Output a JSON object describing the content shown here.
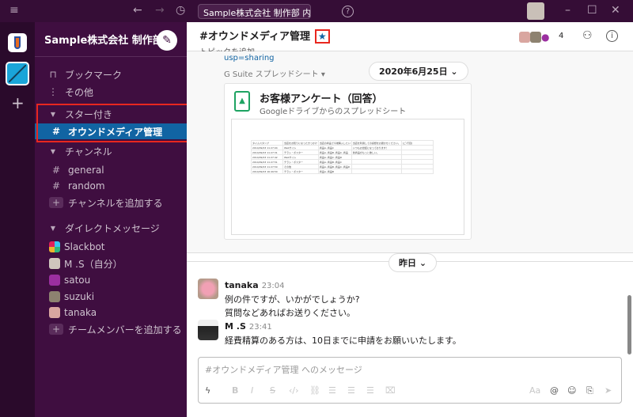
{
  "topbar": {
    "search_placeholder": "Sample株式会社 制作部 内を検...",
    "menu_icon": "≡",
    "back": "←",
    "forward": "→",
    "history": "◷",
    "help": "?",
    "minimize": "–",
    "maximize": "☐",
    "close": "✕"
  },
  "workspace": {
    "name": "Sample株式会社 制作部",
    "chevron": "⌄",
    "add": "+"
  },
  "sidebar": {
    "bookmarks": "ブックマーク",
    "more": "その他",
    "starred_header": "スター付き",
    "starred_items": [
      {
        "label": "オウンドメディア管理"
      }
    ],
    "channels_header": "チャンネル",
    "channels": [
      {
        "label": "general"
      },
      {
        "label": "random"
      }
    ],
    "add_channel": "チャンネルを追加する",
    "dm_header": "ダイレクトメッセージ",
    "dms": [
      {
        "label": "Slackbot"
      },
      {
        "label": "M .S（自分）"
      },
      {
        "label": "satou"
      },
      {
        "label": "suzuki"
      },
      {
        "label": "tanaka"
      }
    ],
    "add_member": "チームメンバーを追加する"
  },
  "channel": {
    "title": "#オウンドメディア管理",
    "topic": "トピックを追加",
    "member_count": "4",
    "star_color": "#1264a3"
  },
  "feed": {
    "link_tail": "usp=sharing",
    "source": "G Suite スプレッドシート",
    "date_pill": "2020年6月25日",
    "card_title": "お客様アンケート（回答）",
    "card_subtitle": "Googleドライブからのスプレッドシート",
    "sheet_rows": [
      [
        "タイムスタンプ",
        "当店をお知りになったきっかけ",
        "当店の商品で今後購入したい",
        "当店を利用しての感想をお聞かせください。",
        "[ご:行目]"
      ],
      [
        "2014/09/03 11:27:04",
        "Webサイト",
        "商品A, 商品C",
        "いつもお世話になっております！",
        ""
      ],
      [
        "2014/09/03 11:27:31",
        "チラシ・ポスター",
        "商品A, 商品B, 商品C, 商品",
        "新商品がもっと欲しい。",
        ""
      ],
      [
        "2014/09/03 11:27:42",
        "Webサイト",
        "商品A, 商品C, 商品D",
        "",
        ""
      ],
      [
        "2014/09/03 11:27:51",
        "チラシ・ポスター",
        "商品A, 商品B, 商品C",
        "",
        ""
      ],
      [
        "2014/09/03 11:27:50",
        "その他",
        "商品A, 商品B, 商品C, 商品D",
        "",
        ""
      ],
      [
        "2014/09/03 16:49:50",
        "チラシ・ポスター",
        "商品A, 商品B",
        "",
        ""
      ]
    ],
    "day_divider": "昨日",
    "messages": [
      {
        "author": "tanaka",
        "time": "23:04",
        "lines": [
          "例の件ですが、いかがでしょうか?",
          "質問などあればお送りください。"
        ]
      },
      {
        "author": "M .S",
        "time": "23:41",
        "lines": [
          "経費精算のある方は、10日までに申請をお願いいたします。"
        ]
      }
    ]
  },
  "composer": {
    "placeholder": "#オウンドメディア管理 へのメッセージ",
    "format_label": "Aa"
  }
}
